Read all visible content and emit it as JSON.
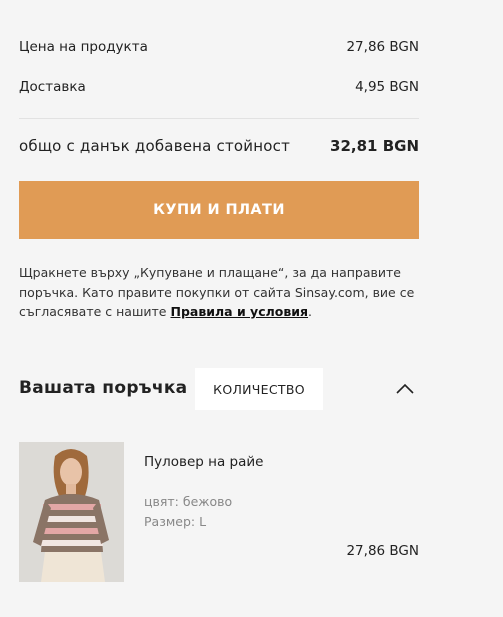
{
  "summary": {
    "product_price_label": "Цена на продукта",
    "product_price_value": "27,86 BGN",
    "shipping_label": "Доставка",
    "shipping_value": "4,95 BGN",
    "total_label": "общо с данък добавена стойност",
    "total_value": "32,81 BGN"
  },
  "buy_button": {
    "label": "КУПИ И ПЛАТИ"
  },
  "notice": {
    "text": "Щракнете върху „Купуване и плащане“, за да направите поръчка. Като правите покупки от сайта Sinsay.com, вие се съгласявате с нашите ",
    "link": "Правила и условия",
    "end": "."
  },
  "order": {
    "title": "Вашата поръчка",
    "quantity_button": "КОЛИЧЕСТВО",
    "toggle_icon": "chevron-up-icon"
  },
  "item": {
    "name": "Пуловер на райе",
    "color": "цвят: бежово",
    "size": "Размер: L",
    "price": "27,86 BGN"
  },
  "colors": {
    "accent": "#e09b55",
    "background": "#f5f5f5"
  }
}
